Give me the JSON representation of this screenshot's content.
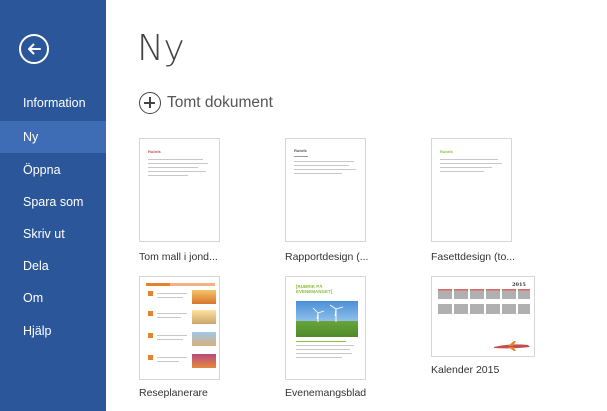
{
  "sidebar": {
    "back_label": "Tillbaka",
    "items": [
      {
        "label": "Information"
      },
      {
        "label": "Ny"
      },
      {
        "label": "Öppna"
      },
      {
        "label": "Spara som"
      },
      {
        "label": "Skriv ut"
      },
      {
        "label": "Dela"
      },
      {
        "label": "Om"
      },
      {
        "label": "Hjälp"
      }
    ],
    "active_item": "Ny",
    "background_color": "#2b579a",
    "active_color": "#3e6db5"
  },
  "main": {
    "title": "Ny",
    "blank_document_label": "Tomt dokument",
    "templates": [
      {
        "label": "Tom mall i jond...",
        "heading": "Rubrik"
      },
      {
        "label": "Rapportdesign (...",
        "heading": "Rubrik"
      },
      {
        "label": "Fasettdesign (to...",
        "heading": "Rubrik"
      },
      {
        "label": "Reseplanerare"
      },
      {
        "label": "Evenemangsblad",
        "heading": "[RUBRIK PÅ EVENEMANGET]"
      },
      {
        "label": "Kalender 2015",
        "heading": "2015"
      }
    ]
  },
  "colors": {
    "accent_red": "#c0504d",
    "accent_green": "#8bbd3a",
    "accent_orange": "#e8812a"
  }
}
